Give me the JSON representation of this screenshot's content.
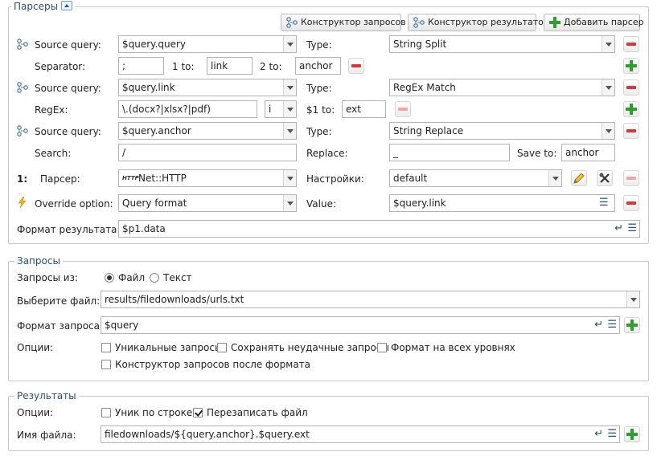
{
  "parsers": {
    "legend": "Парсеры",
    "toolbar": {
      "query_builder": "Конструктор запросов",
      "result_builder": "Конструктор результатов",
      "add_parser": "Добавить парсер"
    },
    "row1": {
      "label": "Source query:",
      "value": "$query.query",
      "type_label": "Type:",
      "type_value": "String Split"
    },
    "row1b": {
      "label": "Separator:",
      "separator": ";",
      "to1_label": "1 to:",
      "to1": "link",
      "to2_label": "2 to:",
      "to2": "anchor"
    },
    "row2": {
      "label": "Source query:",
      "value": "$query.link",
      "type_label": "Type:",
      "type_value": "RegEx Match"
    },
    "row2b": {
      "label": "RegEx:",
      "regex": "\\.(docx?|xlsx?|pdf)",
      "flag": "i",
      "to_label": "$1 to:",
      "to": "ext"
    },
    "row3": {
      "label": "Source query:",
      "value": "$query.anchor",
      "type_label": "Type:",
      "type_value": "String Replace"
    },
    "row3b": {
      "label": "Search:",
      "search": "/",
      "replace_label": "Replace:",
      "replace": "_",
      "save_label": "Save to:",
      "save": "anchor"
    },
    "parser": {
      "index": "1:",
      "label": "Парсер:",
      "value": "Net::HTTP",
      "settings_label": "Настройки:",
      "settings_value": "default"
    },
    "override": {
      "label": "Override option:",
      "value": "Query format",
      "value_label": "Value:",
      "val": "$query.link"
    },
    "result_format": {
      "label": "Формат результата:",
      "value": "$p1.data"
    }
  },
  "queries": {
    "legend": "Запросы",
    "from_label": "Запросы из:",
    "opt_file": "Файл",
    "opt_text": "Текст",
    "file_label": "Выберите файл:",
    "file_value": "results/filedownloads/urls.txt",
    "format_label": "Формат запроса:",
    "format_value": "$query",
    "options_label": "Опции:",
    "unique": "Уникальные запросы",
    "save_failed": "Сохранять неудачные запросы",
    "format_all": "Формат на всех уровнях",
    "builder_after": "Конструктор запросов после формата"
  },
  "results": {
    "legend": "Результаты",
    "options_label": "Опции:",
    "unique_line": "Уник по строке",
    "overwrite": "Перезаписать файл",
    "filename_label": "Имя файла:",
    "filename_value": "filedownloads/${query.anchor}.$query.ext"
  },
  "colors": {
    "legend": "#2a4f7a",
    "minus": "#d9383a",
    "plus": "#2e9e2e",
    "border": "#c8c8c8"
  },
  "checkboxes": {
    "unique": false,
    "save_failed": false,
    "format_all": false,
    "builder_after": false,
    "unique_line": false,
    "overwrite": true
  },
  "radio_selected": "Файл"
}
